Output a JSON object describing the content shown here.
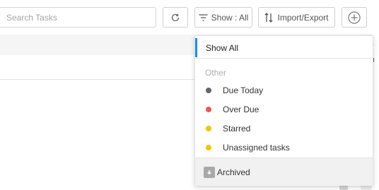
{
  "toolbar": {
    "search_placeholder": "Search Tasks",
    "refresh_icon": "refresh-icon",
    "show_label": "Show : All",
    "import_export_label": "Import/Export",
    "add_icon": "plus-circle-icon"
  },
  "dropdown": {
    "show_all": "Show All",
    "section_heading": "Other",
    "items": [
      {
        "label": "Due Today",
        "color": "#5f6670"
      },
      {
        "label": "Over Due",
        "color": "#f2555a"
      },
      {
        "label": "Starred",
        "color": "#f5c400"
      },
      {
        "label": "Unassigned tasks",
        "color": "#f5c400"
      }
    ],
    "footer_label": "Archived",
    "accent": "#1a8cff"
  }
}
